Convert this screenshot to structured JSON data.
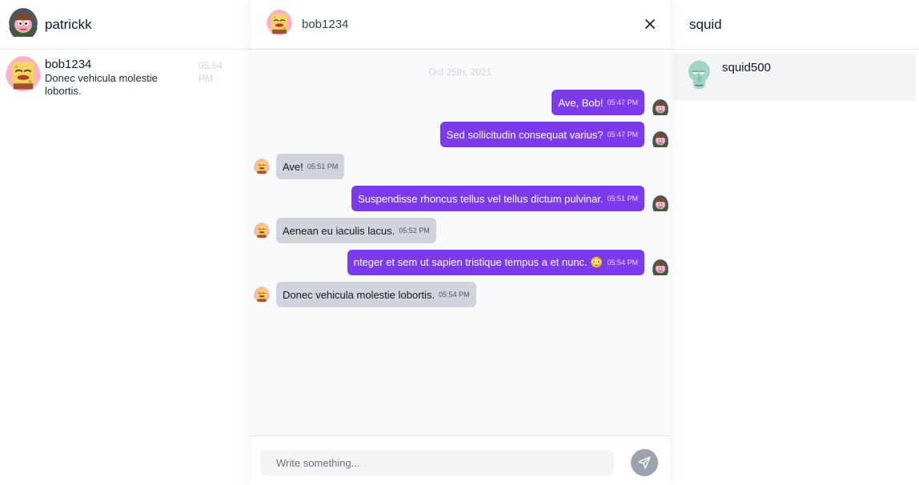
{
  "left": {
    "current_user": "patrickk",
    "conversations": [
      {
        "name": "bob1234",
        "preview": "Donec vehicula molestie lobortis.",
        "time": "05:54 PM"
      }
    ]
  },
  "chat": {
    "contact_name": "bob1234",
    "date_separator": "Oct 25th, 2021",
    "messages": [
      {
        "direction": "out",
        "text": "Ave, Bob!",
        "time": "05:47 PM"
      },
      {
        "direction": "out",
        "text": "Sed sollicitudin consequat varius?",
        "time": "05:47 PM"
      },
      {
        "direction": "in",
        "text": "Ave!",
        "time": "05:51 PM"
      },
      {
        "direction": "out",
        "text": "Suspendisse rhoncus tellus vel tellus dictum pulvinar.",
        "time": "05:51 PM"
      },
      {
        "direction": "in",
        "text": "Aenean eu iaculis lacus.",
        "time": "05:52 PM"
      },
      {
        "direction": "out",
        "text": "nteger et sem ut sapien tristique tempus a et nunc. 😳",
        "time": "05:54 PM"
      },
      {
        "direction": "in",
        "text": "Donec vehicula molestie lobortis.",
        "time": "05:54 PM"
      }
    ],
    "composer": {
      "placeholder": "Write something..."
    }
  },
  "search": {
    "query": "squid",
    "results": [
      {
        "name": "squid500"
      }
    ]
  },
  "colors": {
    "outgoing_bubble": "#7c3aed",
    "incoming_bubble": "#d1d5db",
    "send_button": "#9ca3af"
  },
  "icons": {
    "close": "close-icon",
    "send": "send-icon"
  }
}
